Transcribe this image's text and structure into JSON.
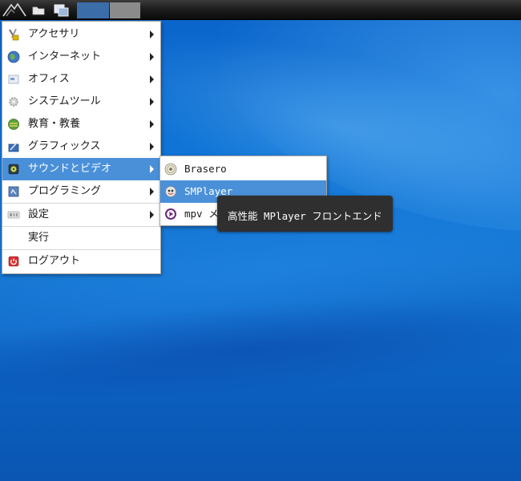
{
  "panel": {
    "start_icon": "distro-logo-icon",
    "folder_icon": "folder-icon",
    "show_desktop_icon": "show-desktop-icon",
    "workspaces": [
      "workspace-1",
      "workspace-2"
    ]
  },
  "menu": {
    "items": [
      {
        "label": "アクセサリ",
        "icon": "accessories-icon",
        "submenu": true
      },
      {
        "label": "インターネット",
        "icon": "globe-icon",
        "submenu": true
      },
      {
        "label": "オフィス",
        "icon": "office-icon",
        "submenu": true
      },
      {
        "label": "システムツール",
        "icon": "gear-icon",
        "submenu": true
      },
      {
        "label": "教育・教養",
        "icon": "education-icon",
        "submenu": true
      },
      {
        "label": "グラフィックス",
        "icon": "graphics-icon",
        "submenu": true
      },
      {
        "label": "サウンドとビデオ",
        "icon": "multimedia-icon",
        "submenu": true,
        "active": true
      },
      {
        "label": "プログラミング",
        "icon": "programming-icon",
        "submenu": true
      },
      {
        "label": "設定",
        "icon": "settings-icon",
        "submenu": true
      },
      {
        "label": "実行",
        "icon": "",
        "submenu": false
      },
      {
        "label": "ログアウト",
        "icon": "power-icon",
        "submenu": false
      }
    ]
  },
  "submenu": {
    "items": [
      {
        "label": "Brasero",
        "icon": "disc-icon"
      },
      {
        "label": "SMPlayer",
        "icon": "smplayer-icon",
        "highlighted": true
      },
      {
        "label": "mpv メ",
        "icon": "mpv-icon"
      }
    ]
  },
  "tooltip": {
    "text": "高性能 MPlayer フロントエンド"
  },
  "colors": {
    "highlight": "#4a90d9",
    "panel": "#1e1e1e",
    "tooltip_bg": "#2f2f2f",
    "desktop": "#0f74d6"
  }
}
